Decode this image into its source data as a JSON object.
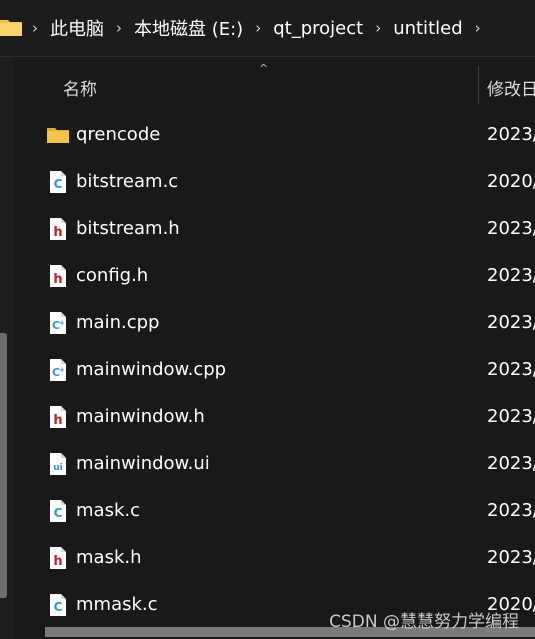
{
  "breadcrumb": {
    "items": [
      "此电脑",
      "本地磁盘 (E:)",
      "qt_project",
      "untitled"
    ]
  },
  "columns": {
    "name": "名称",
    "date": "修改日"
  },
  "files": [
    {
      "name": "qrencode",
      "date": "2023/",
      "icon": "folder-icon"
    },
    {
      "name": "bitstream.c",
      "date": "2020/",
      "icon": "c-file-icon"
    },
    {
      "name": "bitstream.h",
      "date": "2023/",
      "icon": "h-file-icon"
    },
    {
      "name": "config.h",
      "date": "2023/",
      "icon": "h-file-icon"
    },
    {
      "name": "main.cpp",
      "date": "2023/",
      "icon": "cpp-file-icon"
    },
    {
      "name": "mainwindow.cpp",
      "date": "2023/",
      "icon": "cpp-file-icon"
    },
    {
      "name": "mainwindow.h",
      "date": "2023/",
      "icon": "h-file-icon"
    },
    {
      "name": "mainwindow.ui",
      "date": "2023/",
      "icon": "ui-file-icon"
    },
    {
      "name": "mask.c",
      "date": "2023/",
      "icon": "c-file-icon"
    },
    {
      "name": "mask.h",
      "date": "2023/",
      "icon": "h-file-icon"
    },
    {
      "name": "mmask.c",
      "date": "2020/",
      "icon": "c-file-icon"
    }
  ],
  "watermark": "CSDN @慧慧努力学编程",
  "colors": {
    "background": "#191919",
    "folder": "#f4c34c",
    "c_icon": "#3a8fd6",
    "h_icon": "#b4262a",
    "ui_icon": "#3a8fd6"
  }
}
